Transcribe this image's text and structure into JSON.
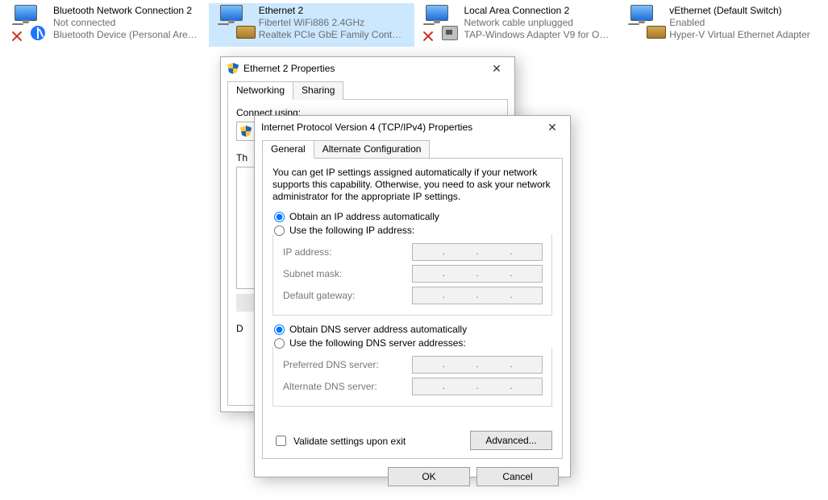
{
  "adapters": [
    {
      "name": "Bluetooth Network Connection 2",
      "status": "Not connected",
      "device": "Bluetooth Device (Personal Area ...",
      "error": true,
      "aux": "bt"
    },
    {
      "name": "Ethernet 2",
      "status": "Fibertel WiFi886 2.4GHz",
      "device": "Realtek PCIe GbE Family Controll...",
      "error": false,
      "aux": "nic",
      "selected": true
    },
    {
      "name": "Local Area Connection 2",
      "status": "Network cable unplugged",
      "device": "TAP-Windows Adapter V9 for Ope...",
      "error": true,
      "aux": "plug"
    },
    {
      "name": "vEthernet (Default Switch)",
      "status": "Enabled",
      "device": "Hyper-V Virtual Ethernet Adapter",
      "error": false,
      "aux": "vnic"
    }
  ],
  "propsDialog": {
    "title": "Ethernet 2 Properties",
    "tabs": {
      "networking": "Networking",
      "sharing": "Sharing"
    },
    "connectUsing": "Connect using:",
    "thisConn": "This connection uses:"
  },
  "ipv4Dialog": {
    "title": "Internet Protocol Version 4 (TCP/IPv4) Properties",
    "tabs": {
      "general": "General",
      "altconf": "Alternate Configuration"
    },
    "desc": "You can get IP settings assigned automatically if your network supports this capability. Otherwise, you need to ask your network administrator for the appropriate IP settings.",
    "radioIP": {
      "auto": "Obtain an IP address automatically",
      "manual": "Use the following IP address:"
    },
    "ipFields": {
      "ip": "IP address:",
      "mask": "Subnet mask:",
      "gw": "Default gateway:"
    },
    "radioDNS": {
      "auto": "Obtain DNS server address automatically",
      "manual": "Use the following DNS server addresses:"
    },
    "dnsFields": {
      "pref": "Preferred DNS server:",
      "alt": "Alternate DNS server:"
    },
    "validate": "Validate settings upon exit",
    "advanced": "Advanced...",
    "ok": "OK",
    "cancel": "Cancel"
  }
}
